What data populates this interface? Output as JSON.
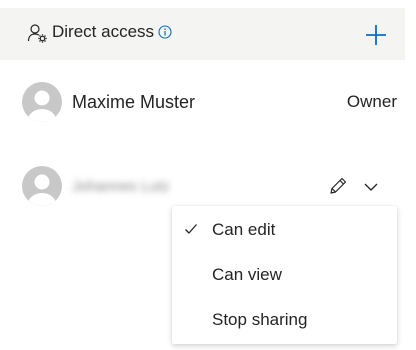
{
  "header": {
    "title": "Direct access",
    "people_icon": "people-settings-icon",
    "info_icon": "info-icon",
    "add_icon": "plus-icon",
    "accent_color": "#0f6cbd"
  },
  "people": [
    {
      "name": "Maxime Muster",
      "role": "Owner"
    },
    {
      "name": "Johannes Lutz",
      "actions": [
        "pencil-icon",
        "chevron-down-icon"
      ]
    }
  ],
  "permission_menu": {
    "items": [
      {
        "label": "Can edit",
        "checked": true
      },
      {
        "label": "Can view",
        "checked": false
      },
      {
        "label": "Stop sharing",
        "checked": false
      }
    ]
  }
}
